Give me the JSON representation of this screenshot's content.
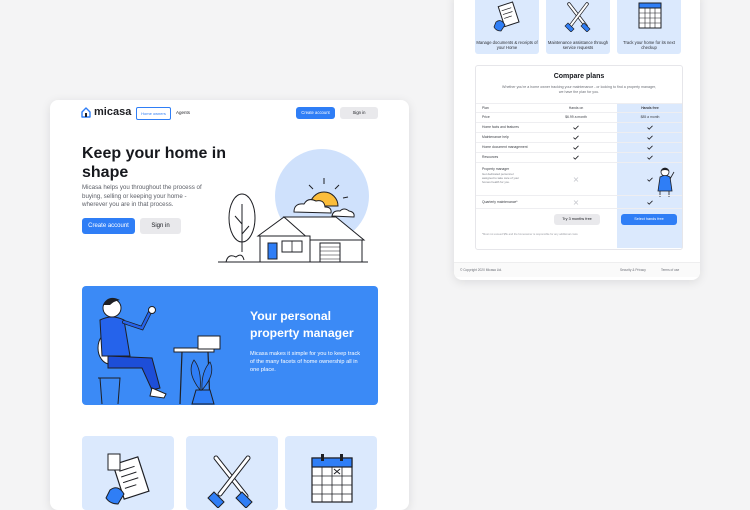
{
  "brand": {
    "name": "micasa"
  },
  "nav": {
    "links": [
      "Home owners",
      "Agents"
    ],
    "create_account": "Create account",
    "sign_in": "Sign in"
  },
  "hero": {
    "title": "Keep your home in shape",
    "subtitle": "Micasa helps you throughout the process of buying, selling or keeping your home - wherever you are in that process.",
    "create_account": "Create account",
    "sign_in": "Sign in"
  },
  "manager": {
    "title": "Your personal property manager",
    "text": "Micasa makes it simple for you to keep track of the many facets of home ownership all in one place."
  },
  "features": [
    {
      "icon": "document-icon",
      "text": "Manage documents & receipts of your Home"
    },
    {
      "icon": "tools-icon",
      "text": "Maintenance assistance through service requests"
    },
    {
      "icon": "calendar-icon",
      "text": "Track your home for its next checkup"
    }
  ],
  "compare": {
    "title": "Compare plans",
    "subtitle": "Whether you're a home owner tracking your maintenance - or looking to find a property manager, we have the plan for you.",
    "headers": [
      "Plan",
      "Hands on",
      "Hands free"
    ],
    "rows": [
      {
        "label": "Price",
        "hands_on": "$6.99 a month",
        "hands_free": "$85 a month"
      },
      {
        "label": "Home facts and features",
        "hands_on": "check",
        "hands_free": "check"
      },
      {
        "label": "Maintenance help",
        "hands_on": "check",
        "hands_free": "check"
      },
      {
        "label": "Home document management",
        "hands_on": "check",
        "hands_free": "check"
      },
      {
        "label": "Resources",
        "hands_on": "check",
        "hands_free": "check"
      },
      {
        "label": "Property manager",
        "detail": "Get dedicated personnel assigned to take care of your homes health for you.",
        "hands_on": "cross",
        "hands_free": "check"
      },
      {
        "label": "Quarterly maintenance*",
        "hands_on": "cross",
        "hands_free": "check"
      }
    ],
    "try_button": "Try 3 months free",
    "select_button": "Select hands free",
    "footnote": "*Must not exceed $5k and the homeowner is responsible for any additional costs"
  },
  "footer": {
    "copyright": "© Copyright 2020 Micasa Ltd.",
    "links": [
      "Security & Privacy",
      "Terms of use"
    ]
  },
  "colors": {
    "accent": "#2f7ef6",
    "soft_blue": "#dbe9fd",
    "text": "#16181d"
  }
}
